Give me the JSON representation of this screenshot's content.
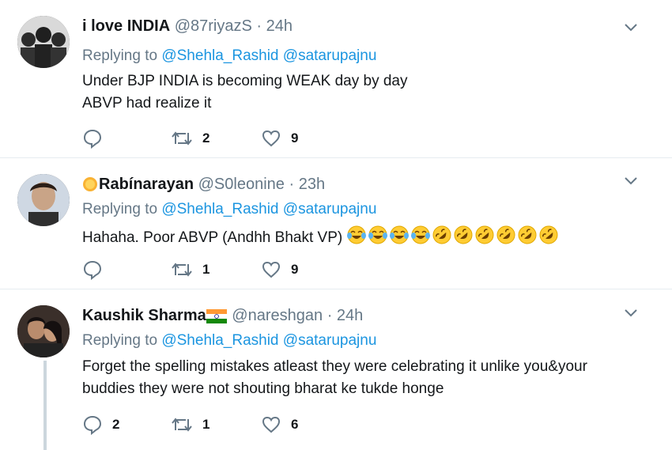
{
  "tweets": [
    {
      "name": "i love INDIA",
      "handle": "@87riyazS",
      "time": "24h",
      "replying_prefix": "Replying to",
      "mentions": [
        "@Shehla_Rashid",
        "@satarupajnu"
      ],
      "lines": [
        "Under BJP INDIA is becoming WEAK day by day",
        "ABVP had realize it"
      ],
      "reply_count": "",
      "retweet_count": "2",
      "like_count": "9"
    },
    {
      "name": "Rabínarayan",
      "handle": "@S0leonine",
      "time": "23h",
      "replying_prefix": "Replying to",
      "mentions": [
        "@Shehla_Rashid",
        "@satarupajnu"
      ],
      "lines": [
        "Hahaha. Poor ABVP (Andhh Bhakt VP)"
      ],
      "emojis": [
        "face-with-tears-of-joy",
        "face-with-tears-of-joy",
        "face-with-tears-of-joy",
        "face-with-tears-of-joy",
        "rolling-on-floor-laughing",
        "rolling-on-floor-laughing",
        "rolling-on-floor-laughing",
        "rolling-on-floor-laughing",
        "rolling-on-floor-laughing",
        "rolling-on-floor-laughing"
      ],
      "reply_count": "",
      "retweet_count": "1",
      "like_count": "9"
    },
    {
      "name": "Kaushik Sharma",
      "handle": "@nareshgan",
      "time": "24h",
      "replying_prefix": "Replying to",
      "mentions": [
        "@Shehla_Rashid",
        "@satarupajnu"
      ],
      "lines": [
        "Forget the spelling mistakes atleast they were celebrating it unlike you&your",
        "buddies they were not shouting bharat ke tukde honge"
      ],
      "reply_count": "2",
      "retweet_count": "1",
      "like_count": "6"
    }
  ],
  "separator": "·",
  "colors": {
    "secondary_text": "#657786",
    "mention": "#1b95e0",
    "divider": "#e6ecf0",
    "thread_line": "#ccd6dd"
  },
  "icons": [
    "reply-icon",
    "retweet-icon",
    "like-icon",
    "chevron-down-icon",
    "sun-emoji-icon",
    "india-flag-icon"
  ]
}
